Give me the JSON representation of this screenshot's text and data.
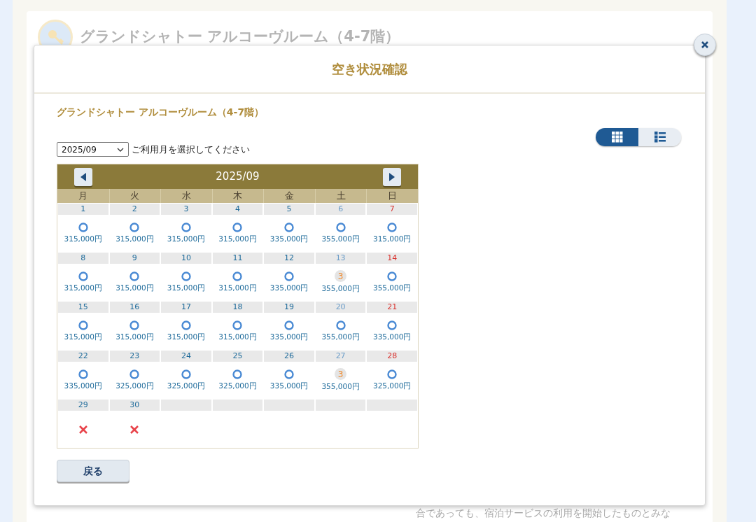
{
  "background": {
    "title": "グランドシャトー アルコーヴルーム（4-7階）",
    "footer_text": "合であっても、宿泊サービスの利用を開始したものとみな"
  },
  "modal": {
    "title": "空き状況確認",
    "room_name": "グランドシャトー アルコーヴルーム（4-7階）",
    "month_select": {
      "value": "2025/09"
    },
    "month_hint": "ご利用月を選択してください",
    "view_toggle": [
      {
        "kind": "grid",
        "selected": true
      },
      {
        "kind": "list",
        "selected": false
      }
    ],
    "calendar": {
      "month": "2025/09",
      "weekdays": [
        "月",
        "火",
        "水",
        "木",
        "金",
        "土",
        "日"
      ],
      "weeks": [
        {
          "days": [
            {
              "date": "1",
              "color": "#1d6a9a",
              "kind": "available",
              "price": "315,000円"
            },
            {
              "date": "2",
              "color": "#1d6a9a",
              "kind": "available",
              "price": "315,000円"
            },
            {
              "date": "3",
              "color": "#1d6a9a",
              "kind": "available",
              "price": "315,000円"
            },
            {
              "date": "4",
              "color": "#1d6a9a",
              "kind": "available",
              "price": "315,000円"
            },
            {
              "date": "5",
              "color": "#1d6a9a",
              "kind": "available",
              "price": "335,000円"
            },
            {
              "date": "6",
              "color": "#6a9cc8",
              "kind": "available",
              "price": "355,000円"
            },
            {
              "date": "7",
              "color": "#d9302c",
              "kind": "available",
              "price": "315,000円"
            }
          ]
        },
        {
          "days": [
            {
              "date": "8",
              "color": "#1d6a9a",
              "kind": "available",
              "price": "315,000円"
            },
            {
              "date": "9",
              "color": "#1d6a9a",
              "kind": "available",
              "price": "315,000円"
            },
            {
              "date": "10",
              "color": "#1d6a9a",
              "kind": "available",
              "price": "315,000円"
            },
            {
              "date": "11",
              "color": "#1d6a9a",
              "kind": "available",
              "price": "315,000円"
            },
            {
              "date": "12",
              "color": "#1d6a9a",
              "kind": "available",
              "price": "335,000円"
            },
            {
              "date": "13",
              "color": "#6a9cc8",
              "kind": "few",
              "count": "3",
              "price": "355,000円"
            },
            {
              "date": "14",
              "color": "#d9302c",
              "kind": "available",
              "price": "355,000円"
            }
          ]
        },
        {
          "days": [
            {
              "date": "15",
              "color": "#1d6a9a",
              "kind": "available",
              "price": "315,000円"
            },
            {
              "date": "16",
              "color": "#1d6a9a",
              "kind": "available",
              "price": "315,000円"
            },
            {
              "date": "17",
              "color": "#1d6a9a",
              "kind": "available",
              "price": "315,000円"
            },
            {
              "date": "18",
              "color": "#1d6a9a",
              "kind": "available",
              "price": "315,000円"
            },
            {
              "date": "19",
              "color": "#1d6a9a",
              "kind": "available",
              "price": "335,000円"
            },
            {
              "date": "20",
              "color": "#6a9cc8",
              "kind": "available",
              "price": "355,000円"
            },
            {
              "date": "21",
              "color": "#d9302c",
              "kind": "available",
              "price": "335,000円"
            }
          ]
        },
        {
          "days": [
            {
              "date": "22",
              "color": "#1d6a9a",
              "kind": "available",
              "price": "335,000円"
            },
            {
              "date": "23",
              "color": "#1d6a9a",
              "kind": "available",
              "price": "325,000円"
            },
            {
              "date": "24",
              "color": "#1d6a9a",
              "kind": "available",
              "price": "325,000円"
            },
            {
              "date": "25",
              "color": "#1d6a9a",
              "kind": "available",
              "price": "325,000円"
            },
            {
              "date": "26",
              "color": "#1d6a9a",
              "kind": "available",
              "price": "335,000円"
            },
            {
              "date": "27",
              "color": "#6a9cc8",
              "kind": "few",
              "count": "3",
              "price": "355,000円"
            },
            {
              "date": "28",
              "color": "#d9302c",
              "kind": "available",
              "price": "325,000円"
            }
          ]
        },
        {
          "days": [
            {
              "date": "29",
              "color": "#1d6a9a",
              "kind": "full"
            },
            {
              "date": "30",
              "color": "#1d6a9a",
              "kind": "full"
            },
            {
              "kind": "empty"
            },
            {
              "kind": "empty"
            },
            {
              "kind": "empty"
            },
            {
              "kind": "empty"
            },
            {
              "kind": "empty"
            }
          ]
        }
      ]
    },
    "back_button": "戻る"
  }
}
